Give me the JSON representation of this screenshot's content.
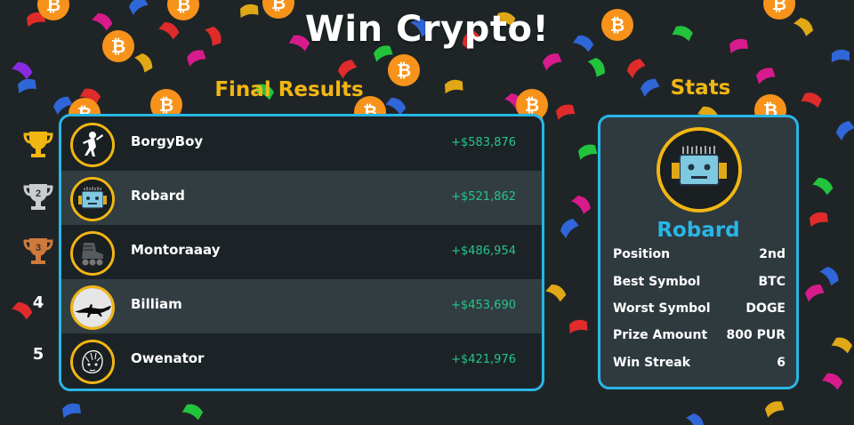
{
  "title": "Win Crypto!",
  "results": {
    "heading": "Final Results",
    "players": [
      {
        "rank_icon": "gold-trophy-icon",
        "avatar": "skater-avatar-icon",
        "name": "BorgyBoy",
        "amount": "+$583,876"
      },
      {
        "rank_icon": "silver-trophy-icon",
        "rank_label": "2",
        "avatar": "robot-avatar-icon",
        "name": "Robard",
        "amount": "+$521,862"
      },
      {
        "rank_icon": "bronze-trophy-icon",
        "rank_label": "3",
        "avatar": "rollerskate-avatar-icon",
        "name": "Montoraaay",
        "amount": "+$486,954"
      },
      {
        "rank_label": "4",
        "avatar": "lizard-avatar-icon",
        "name": "Billiam",
        "amount": "+$453,690"
      },
      {
        "rank_label": "5",
        "avatar": "sketch-face-avatar-icon",
        "name": "Owenator",
        "amount": "+$421,976"
      }
    ]
  },
  "stats": {
    "heading": "Stats",
    "avatar": "robot-avatar-icon",
    "player_name": "Robard",
    "rows": [
      {
        "label": "Position",
        "value": "2nd"
      },
      {
        "label": "Best Symbol",
        "value": "BTC"
      },
      {
        "label": "Worst Symbol",
        "value": "DOGE"
      },
      {
        "label": "Prize Amount",
        "value": "800 PUR"
      },
      {
        "label": "Win Streak",
        "value": "6"
      }
    ]
  },
  "decor": {
    "coin_icon": "bitcoin-coin-icon",
    "coin_glyph": "₿",
    "confetti_colors": [
      "#e02b2b",
      "#d81b8c",
      "#2f66d8",
      "#22c43c",
      "#e0a816",
      "#8a2be2"
    ]
  },
  "colors": {
    "background": "#1f2527",
    "accent_gold": "#f2b613",
    "accent_blue": "#29b6e6",
    "money_green": "#27c489",
    "coin_orange": "#f7931a"
  }
}
